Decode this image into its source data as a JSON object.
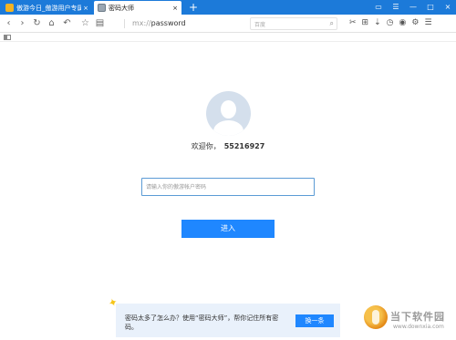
{
  "tabs": [
    {
      "label": "傲游今日_傲游用户专属的",
      "close": "×",
      "favicon": "yellow-logo-icon"
    },
    {
      "label": "密码大师",
      "close": "×",
      "favicon": "password-master-icon"
    }
  ],
  "new_tab": "+",
  "window_controls": [
    "▭",
    "☰",
    "—",
    "□",
    "×"
  ],
  "nav": {
    "back": "‹",
    "forward": "›",
    "refresh": "↻",
    "home": "⌂",
    "undo": "↶",
    "favorite": "☆",
    "reader": "▤",
    "address_scheme": "mx://",
    "address_path": "password",
    "search_placeholder": "百度",
    "search_icon": "⌕"
  },
  "toolbar_icons": [
    "✂",
    "⊞",
    "⇣",
    "◷",
    "◉",
    "⚙",
    "☰"
  ],
  "main": {
    "welcome_prefix": "欢迎你，",
    "user_id": "55216927",
    "password_placeholder": "请输入你的傲游帐户密码",
    "enter_label": "进入"
  },
  "tip": {
    "text": "密码太多了怎么办？使用“密码大师”，帮你记住所有密码。",
    "button": "换一条"
  },
  "watermark": {
    "title": "当下软件园",
    "url": "www.downxia.com"
  },
  "colors": {
    "tabbar": "#1c7ad9",
    "accent": "#1f87ff",
    "tip_bg": "#e9f1fb"
  }
}
